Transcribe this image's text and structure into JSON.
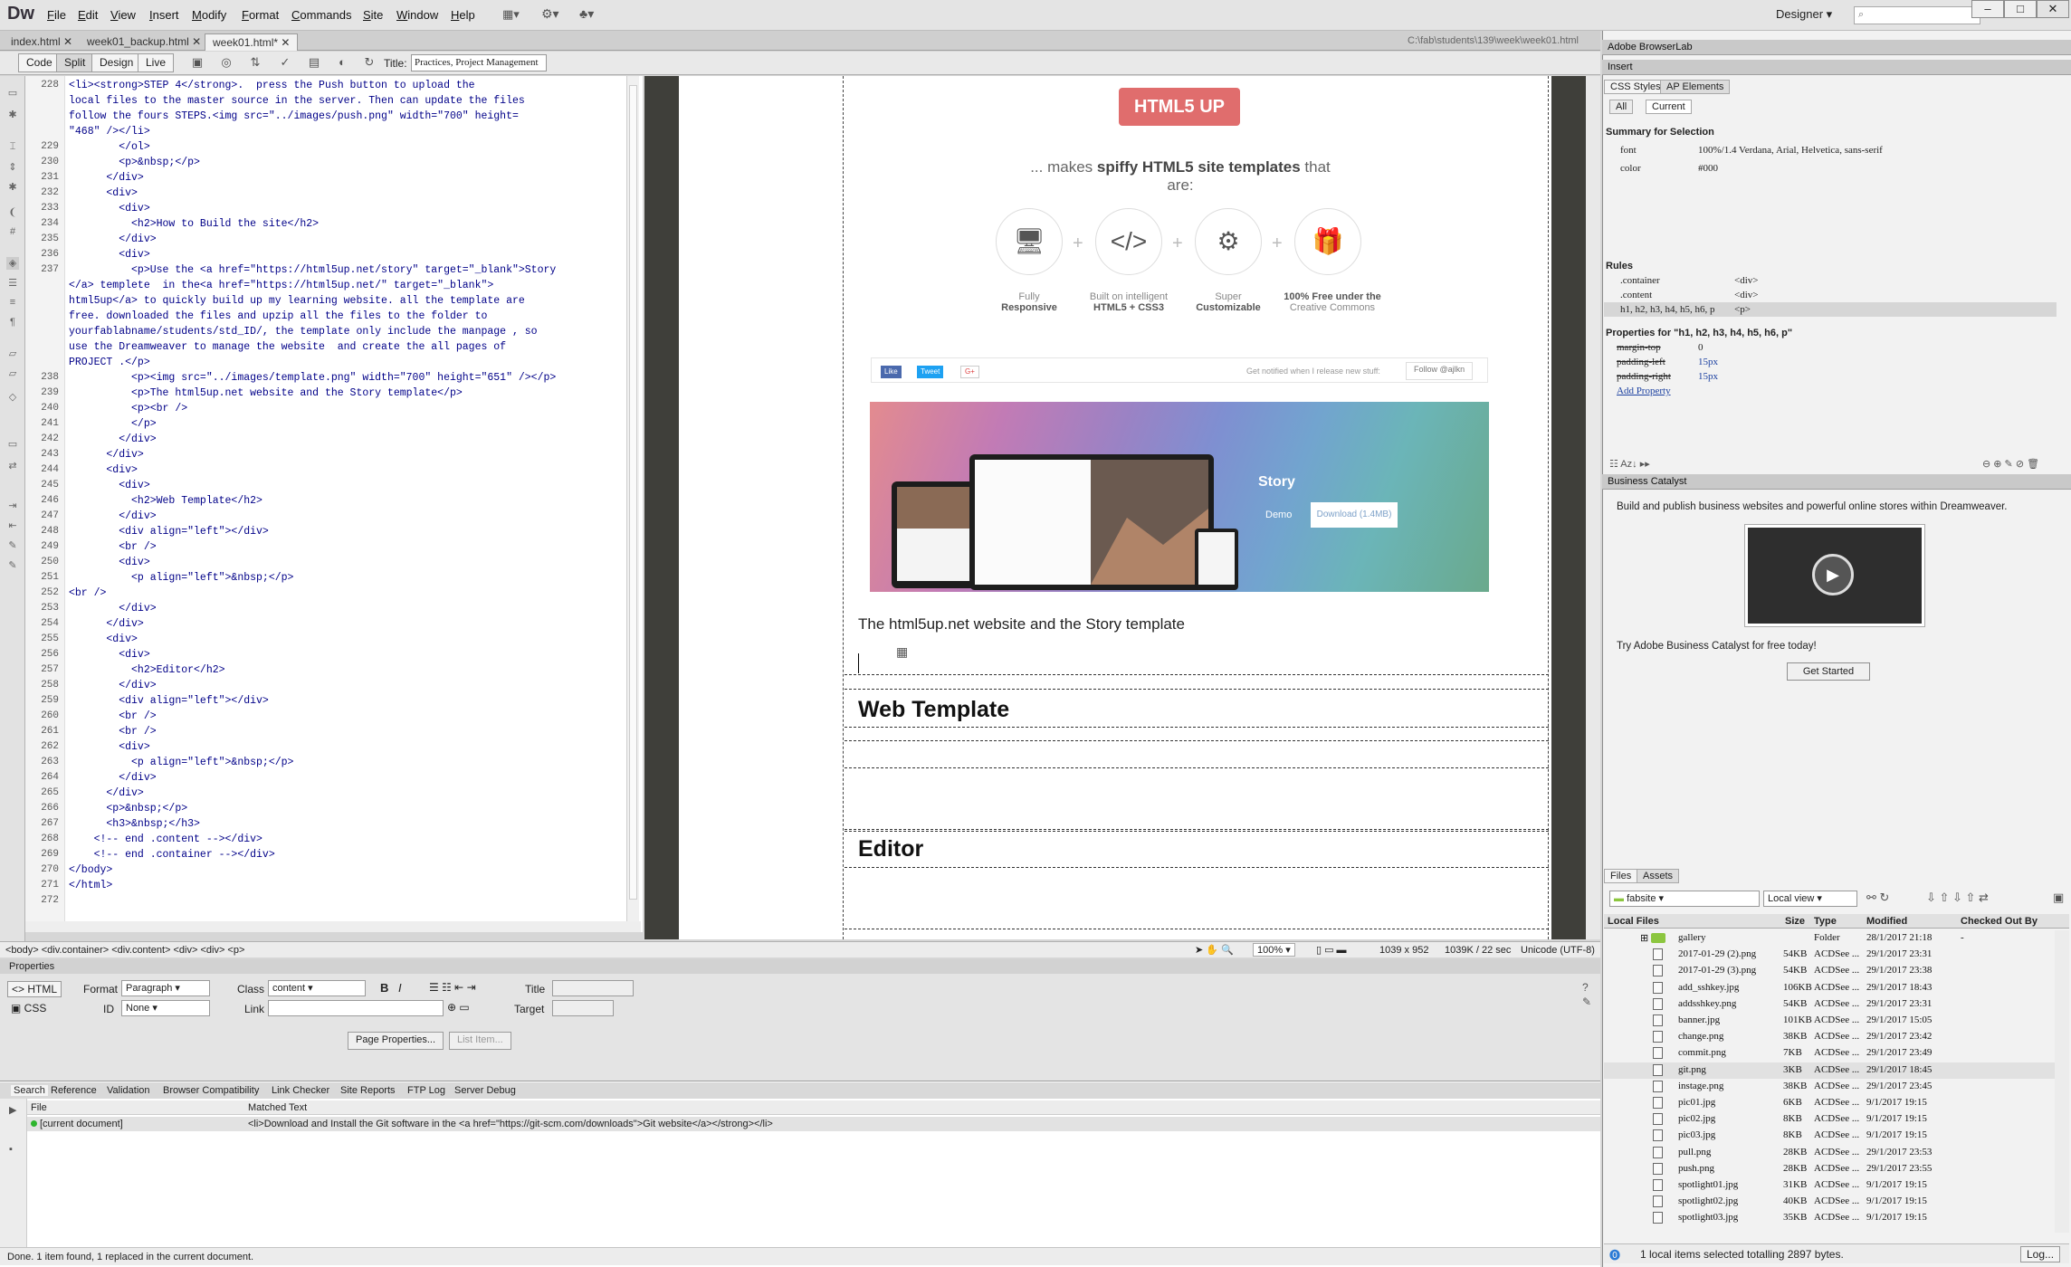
{
  "app": {
    "logo": "Dw",
    "menus": [
      "File",
      "Edit",
      "View",
      "Insert",
      "Modify",
      "Format",
      "Commands",
      "Site",
      "Window",
      "Help"
    ],
    "workspace": "Designer",
    "window_controls": [
      "–",
      "□",
      "✕"
    ]
  },
  "doc_tabs": [
    "index.html",
    "week01_backup.html",
    "week01.html*"
  ],
  "doc_path": "C:\\fab\\students\\139\\week\\week01.html",
  "view_buttons": [
    "Code",
    "Split",
    "Design",
    "Live"
  ],
  "title_label": "Title:",
  "title_value": "Practices, Project Management",
  "code": {
    "lines": [
      {
        "n": "228",
        "t": "<li><strong>STEP 4</strong>.  press the Push button to upload the"
      },
      {
        "n": "",
        "t": "local files to the master source in the server. Then can update the files"
      },
      {
        "n": "",
        "t": "follow the fours STEPS.<img src=\"../images/push.png\" width=\"700\" height="
      },
      {
        "n": "",
        "t": "\"468\" /></li>"
      },
      {
        "n": "229",
        "t": "        </ol>"
      },
      {
        "n": "230",
        "t": "        <p>&nbsp;</p>"
      },
      {
        "n": "231",
        "t": "      </div>"
      },
      {
        "n": "232",
        "t": "      <div>"
      },
      {
        "n": "233",
        "t": "        <div>"
      },
      {
        "n": "234",
        "t": "          <h2>How to Build the site</h2>"
      },
      {
        "n": "235",
        "t": "        </div>"
      },
      {
        "n": "236",
        "t": "        <div>"
      },
      {
        "n": "237",
        "t": "          <p>Use the <a href=\"https://html5up.net/story\" target=\"_blank\">Story"
      },
      {
        "n": "",
        "t": "</a> templete  in the<a href=\"https://html5up.net/\" target=\"_blank\">"
      },
      {
        "n": "",
        "t": "html5up</a> to quickly build up my learning website. all the template are"
      },
      {
        "n": "",
        "t": "free. downloaded the files and upzip all the files to the folder to"
      },
      {
        "n": "",
        "t": "yourfablabname/students/std_ID/, the template only include the manpage , so"
      },
      {
        "n": "",
        "t": "use the Dreamweaver to manage the website  and create the all pages of"
      },
      {
        "n": "",
        "t": "PROJECT .</p>"
      },
      {
        "n": "238",
        "t": "          <p><img src=\"../images/template.png\" width=\"700\" height=\"651\" /></p>"
      },
      {
        "n": "239",
        "t": "          <p>The html5up.net website and the Story template</p>"
      },
      {
        "n": "240",
        "t": "          <p><br />"
      },
      {
        "n": "241",
        "t": "          </p>"
      },
      {
        "n": "242",
        "t": "        </div>"
      },
      {
        "n": "243",
        "t": "      </div>"
      },
      {
        "n": "244",
        "t": "      <div>"
      },
      {
        "n": "245",
        "t": "        <div>"
      },
      {
        "n": "246",
        "t": "          <h2>Web Template</h2>"
      },
      {
        "n": "247",
        "t": "        </div>"
      },
      {
        "n": "248",
        "t": "        <div align=\"left\"></div>"
      },
      {
        "n": "249",
        "t": "        <br />"
      },
      {
        "n": "250",
        "t": "        <div>"
      },
      {
        "n": "251",
        "t": "          <p align=\"left\">&nbsp;</p>"
      },
      {
        "n": "252",
        "t": "<br />"
      },
      {
        "n": "253",
        "t": "        </div>"
      },
      {
        "n": "254",
        "t": "      </div>"
      },
      {
        "n": "255",
        "t": "      <div>"
      },
      {
        "n": "256",
        "t": "        <div>"
      },
      {
        "n": "257",
        "t": "          <h2>Editor</h2>"
      },
      {
        "n": "258",
        "t": "        </div>"
      },
      {
        "n": "259",
        "t": "        <div align=\"left\"></div>"
      },
      {
        "n": "260",
        "t": "        <br />"
      },
      {
        "n": "261",
        "t": "        <br />"
      },
      {
        "n": "262",
        "t": "        <div>"
      },
      {
        "n": "263",
        "t": "          <p align=\"left\">&nbsp;</p>"
      },
      {
        "n": "264",
        "t": "        </div>"
      },
      {
        "n": "265",
        "t": "      </div>"
      },
      {
        "n": "266",
        "t": "      <p>&nbsp;</p>"
      },
      {
        "n": "267",
        "t": "      <h3>&nbsp;</h3>"
      },
      {
        "n": "268",
        "t": "    <!-- end .content --></div>"
      },
      {
        "n": "269",
        "t": "    <!-- end .container --></div>"
      },
      {
        "n": "270",
        "t": "</body>"
      },
      {
        "n": "271",
        "t": "</html>"
      },
      {
        "n": "272",
        "t": ""
      }
    ]
  },
  "design": {
    "logo": "HTML5 UP",
    "tagline_pre": "... makes ",
    "tagline_bold": "spiffy HTML5 site templates",
    "tagline_post": " that are:",
    "features": [
      {
        "icon": "🖥",
        "l1": "Fully",
        "l2": "Responsive"
      },
      {
        "icon": "</>",
        "l1": "Built on intelligent",
        "l2": "HTML5 + CSS3"
      },
      {
        "icon": "⚙",
        "l1": "Super",
        "l2": "Customizable"
      },
      {
        "icon": "🎁",
        "l1": "100% Free under the",
        "l2": "Creative Commons"
      }
    ],
    "share_buttons": [
      "Like",
      "Tweet",
      "G+"
    ],
    "share_note": "Get notified when I release new stuff:",
    "follow": "Follow @ajlkn",
    "banner": {
      "title": "Story",
      "demo": "Demo",
      "download": "Download (1.4MB)"
    },
    "caption": "The html5up.net website and the Story template",
    "heading1": "Web Template",
    "heading2": "Editor"
  },
  "doc_status": {
    "tags": "<body> <div.container> <div.content> <div> <div> <p>",
    "zoom": "100%",
    "size": "1039 x 952",
    "weight": "1039K / 22 sec",
    "encoding": "Unicode (UTF-8)"
  },
  "properties": {
    "title": "Properties",
    "html_tab": "HTML",
    "css_tab": "CSS",
    "format_label": "Format",
    "format_value": "Paragraph",
    "class_label": "Class",
    "class_value": "content",
    "id_label": "ID",
    "id_value": "None",
    "link_label": "Link",
    "title_label": "Title",
    "target_label": "Target",
    "page_props": "Page Properties...",
    "list_item": "List Item..."
  },
  "results": {
    "tabs": [
      "Search",
      "Reference",
      "Validation",
      "Browser Compatibility",
      "Link Checker",
      "Site Reports",
      "FTP Log",
      "Server Debug"
    ],
    "col_file": "File",
    "col_match": "Matched Text",
    "row_file": "[current document]",
    "row_match": "<li>Download and Install the Git software in the <a href=\"https://git-scm.com/downloads\">Git website</a></strong></li>",
    "status": "Done. 1 item found, 1 replaced in the current document."
  },
  "panels": {
    "browserlab": "Adobe BrowserLab",
    "insert": "Insert",
    "css_tabs": [
      "CSS Styles",
      "AP Elements"
    ],
    "mode_tabs": [
      "All",
      "Current"
    ],
    "summary_title": "Summary for Selection",
    "summary": [
      {
        "k": "font",
        "v": "100%/1.4 Verdana, Arial, Helvetica, sans-serif"
      },
      {
        "k": "color",
        "v": "#000"
      }
    ],
    "rules_title": "Rules",
    "rules": [
      {
        "k": ".container",
        "v": "<div>"
      },
      {
        "k": ".content",
        "v": "<div>"
      },
      {
        "k": "h1, h2, h3, h4, h5, h6, p",
        "v": "<p>"
      }
    ],
    "props_title": "Properties for \"h1, h2, h3, h4, h5, h6, p\"",
    "props": [
      {
        "k": "margin-top",
        "v": "0"
      },
      {
        "k": "padding-left",
        "v": "15px"
      },
      {
        "k": "padding-right",
        "v": "15px"
      }
    ],
    "add_property": "Add Property",
    "bc_title": "Business Catalyst",
    "bc_text": "Build and publish business websites and powerful online stores within Dreamweaver.",
    "bc_try": "Try Adobe Business Catalyst for free today!",
    "bc_button": "Get Started",
    "files_tabs": [
      "Files",
      "Assets"
    ],
    "site": "fabsite",
    "view": "Local view",
    "files_cols": [
      "Local Files",
      "Size",
      "Type",
      "Modified",
      "Checked Out By"
    ],
    "files": [
      {
        "name": "gallery",
        "size": "",
        "type": "Folder",
        "mod": "28/1/2017 21:18",
        "chk": "-",
        "folder": true
      },
      {
        "name": "2017-01-29 (2).png",
        "size": "54KB",
        "type": "ACDSee ...",
        "mod": "29/1/2017 23:31"
      },
      {
        "name": "2017-01-29 (3).png",
        "size": "54KB",
        "type": "ACDSee ...",
        "mod": "29/1/2017 23:38"
      },
      {
        "name": "add_sshkey.jpg",
        "size": "106KB",
        "type": "ACDSee ...",
        "mod": "29/1/2017 18:43"
      },
      {
        "name": "addsshkey.png",
        "size": "54KB",
        "type": "ACDSee ...",
        "mod": "29/1/2017 23:31"
      },
      {
        "name": "banner.jpg",
        "size": "101KB",
        "type": "ACDSee ...",
        "mod": "29/1/2017 15:05"
      },
      {
        "name": "change.png",
        "size": "38KB",
        "type": "ACDSee ...",
        "mod": "29/1/2017 23:42"
      },
      {
        "name": "commit.png",
        "size": "7KB",
        "type": "ACDSee ...",
        "mod": "29/1/2017 23:49"
      },
      {
        "name": "git.png",
        "size": "3KB",
        "type": "ACDSee ...",
        "mod": "29/1/2017 18:45",
        "sel": true
      },
      {
        "name": "instage.png",
        "size": "38KB",
        "type": "ACDSee ...",
        "mod": "29/1/2017 23:45"
      },
      {
        "name": "pic01.jpg",
        "size": "6KB",
        "type": "ACDSee ...",
        "mod": "9/1/2017 19:15"
      },
      {
        "name": "pic02.jpg",
        "size": "8KB",
        "type": "ACDSee ...",
        "mod": "9/1/2017 19:15"
      },
      {
        "name": "pic03.jpg",
        "size": "8KB",
        "type": "ACDSee ...",
        "mod": "9/1/2017 19:15"
      },
      {
        "name": "pull.png",
        "size": "28KB",
        "type": "ACDSee ...",
        "mod": "29/1/2017 23:53"
      },
      {
        "name": "push.png",
        "size": "28KB",
        "type": "ACDSee ...",
        "mod": "29/1/2017 23:55"
      },
      {
        "name": "spotlight01.jpg",
        "size": "31KB",
        "type": "ACDSee ...",
        "mod": "9/1/2017 19:15"
      },
      {
        "name": "spotlight02.jpg",
        "size": "40KB",
        "type": "ACDSee ...",
        "mod": "9/1/2017 19:15"
      },
      {
        "name": "spotlight03.jpg",
        "size": "35KB",
        "type": "ACDSee ...",
        "mod": "9/1/2017 19:15"
      }
    ],
    "files_status": "1 local items selected totalling 2897 bytes.",
    "log_btn": "Log..."
  }
}
